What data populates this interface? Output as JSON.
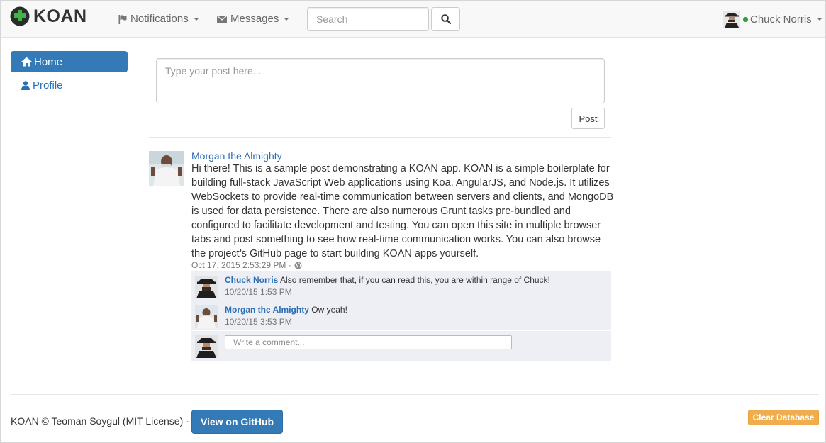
{
  "navbar": {
    "brand": "KOAN",
    "logo_icon": "puzzle-piece-icon",
    "notifications_label": "Notifications",
    "messages_label": "Messages",
    "search_placeholder": "Search",
    "user_name": "Chuck Norris",
    "user_status_color": "#2f9e41"
  },
  "sidebar": {
    "items": [
      {
        "label": "Home",
        "icon": "home-icon",
        "active": true
      },
      {
        "label": "Profile",
        "icon": "user-icon",
        "active": false
      }
    ]
  },
  "compose": {
    "placeholder": "Type your post here...",
    "post_label": "Post"
  },
  "post": {
    "author": "Morgan the Almighty",
    "body": "Hi there! This is a sample post demonstrating a KOAN app. KOAN is a simple boilerplate for building full-stack JavaScript Web applications using Koa, AngularJS, and Node.js. It utilizes WebSockets to provide real-time communication between servers and clients, and MongoDB is used for data persistence. There are also numerous Grunt tasks pre-bundled and configured to facilitate development and testing. You can open this site in multiple browser tabs and post something to see how real-time communication works. You can also browse the project’s GitHub page to start building KOAN apps yourself.",
    "timestamp": "Oct 17, 2015 2:53:29 PM ·",
    "comments": [
      {
        "author": "Chuck Norris",
        "text": "Also remember that, if you can read this, you are within range of Chuck!",
        "date": "10/20/15 1:53 PM"
      },
      {
        "author": "Morgan the Almighty",
        "text": "Ow yeah!",
        "date": "10/20/15 3:53 PM"
      }
    ],
    "comment_placeholder": "Write a comment..."
  },
  "footer": {
    "text": "KOAN © Teoman Soygul (MIT License) ·",
    "github_label": "View on GitHub",
    "clear_label": "Clear Database"
  },
  "colors": {
    "primary": "#337ab7",
    "link": "#2a6fb5",
    "warning": "#f0ad4e",
    "comment_bg": "#edeff5"
  }
}
